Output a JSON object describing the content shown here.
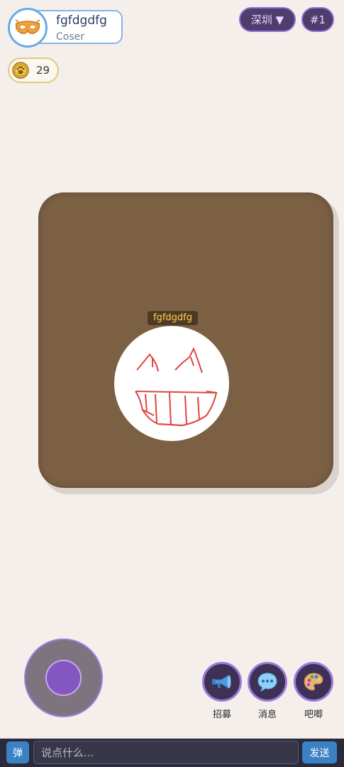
{
  "profile": {
    "name": "fgfdgdfg",
    "role": "Coser",
    "avatar_icon": "orange-mask-icon"
  },
  "top_right": {
    "city_label": "深圳 ▼",
    "rank_label": "#1"
  },
  "coins": {
    "count": "29",
    "icon": "paw-coin-icon"
  },
  "room": {
    "player_name": "fgfdgdfg",
    "player_avatar": "grinning-face-drawing",
    "board_color": "#7c6044"
  },
  "actions": [
    {
      "label": "招募",
      "icon": "megaphone-icon"
    },
    {
      "label": "消息",
      "icon": "speech-bubble-icon"
    },
    {
      "label": "吧唧",
      "icon": "palette-icon"
    }
  ],
  "bottom_bar": {
    "danmu_label": "弹",
    "input_placeholder": "说点什么...",
    "send_label": "发送"
  },
  "colors": {
    "background": "#f5efec",
    "accent_purple": "#9b79dc",
    "button_blue": "#3b82c4"
  }
}
